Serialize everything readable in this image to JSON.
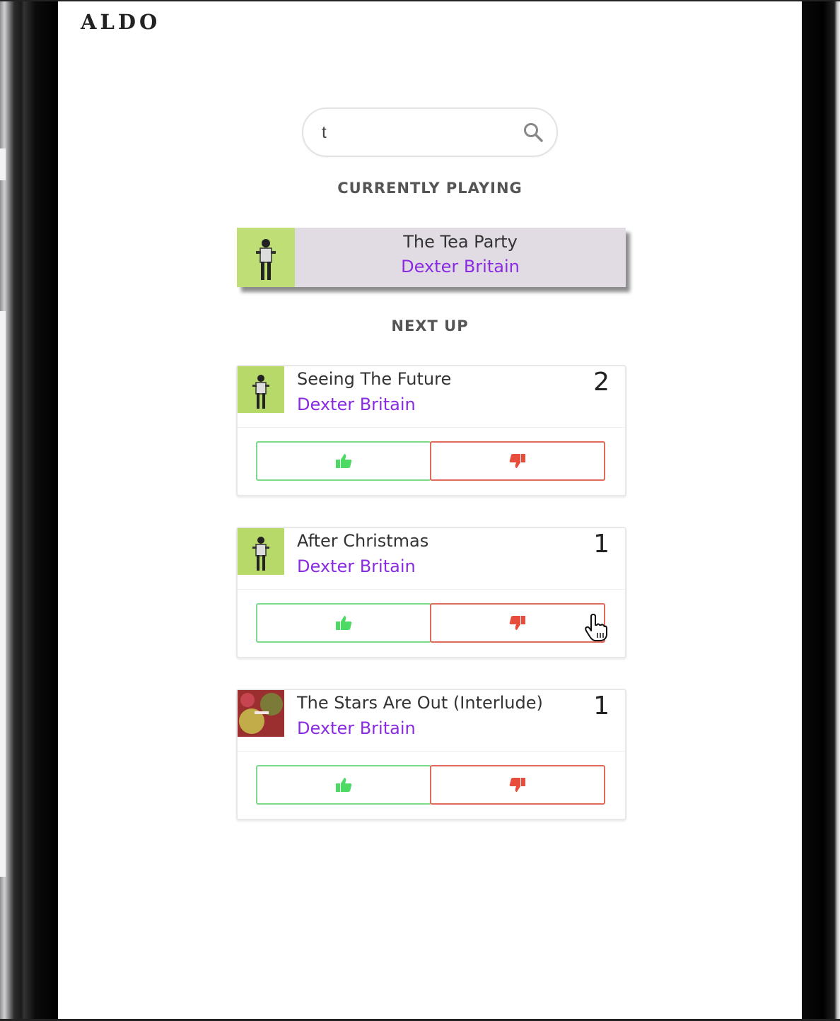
{
  "app": {
    "logo": "ALDO"
  },
  "search": {
    "value": "t",
    "placeholder": ""
  },
  "sections": {
    "currently_playing": "CURRENTLY PLAYING",
    "next_up": "NEXT UP"
  },
  "now_playing": {
    "title": "The Tea Party",
    "artist": "Dexter Britain"
  },
  "queue": [
    {
      "title": "Seeing The Future",
      "artist": "Dexter Britain",
      "votes": "2",
      "art": "figure-on-green"
    },
    {
      "title": "After Christmas",
      "artist": "Dexter Britain",
      "votes": "1",
      "art": "figure-on-green"
    },
    {
      "title": "The Stars Are Out (Interlude)",
      "artist": "Dexter Britain",
      "votes": "1",
      "art": "abstract-red-green"
    }
  ],
  "icons": {
    "search": "search-icon",
    "upvote": "thumbs-up-icon",
    "downvote": "thumbs-down-icon",
    "cursor": "hand-pointer-icon"
  },
  "colors": {
    "artist": "#8a2be2",
    "upvote": "#4cd964",
    "downvote": "#e74c3c",
    "now_playing_bg": "#e1dbe4"
  }
}
